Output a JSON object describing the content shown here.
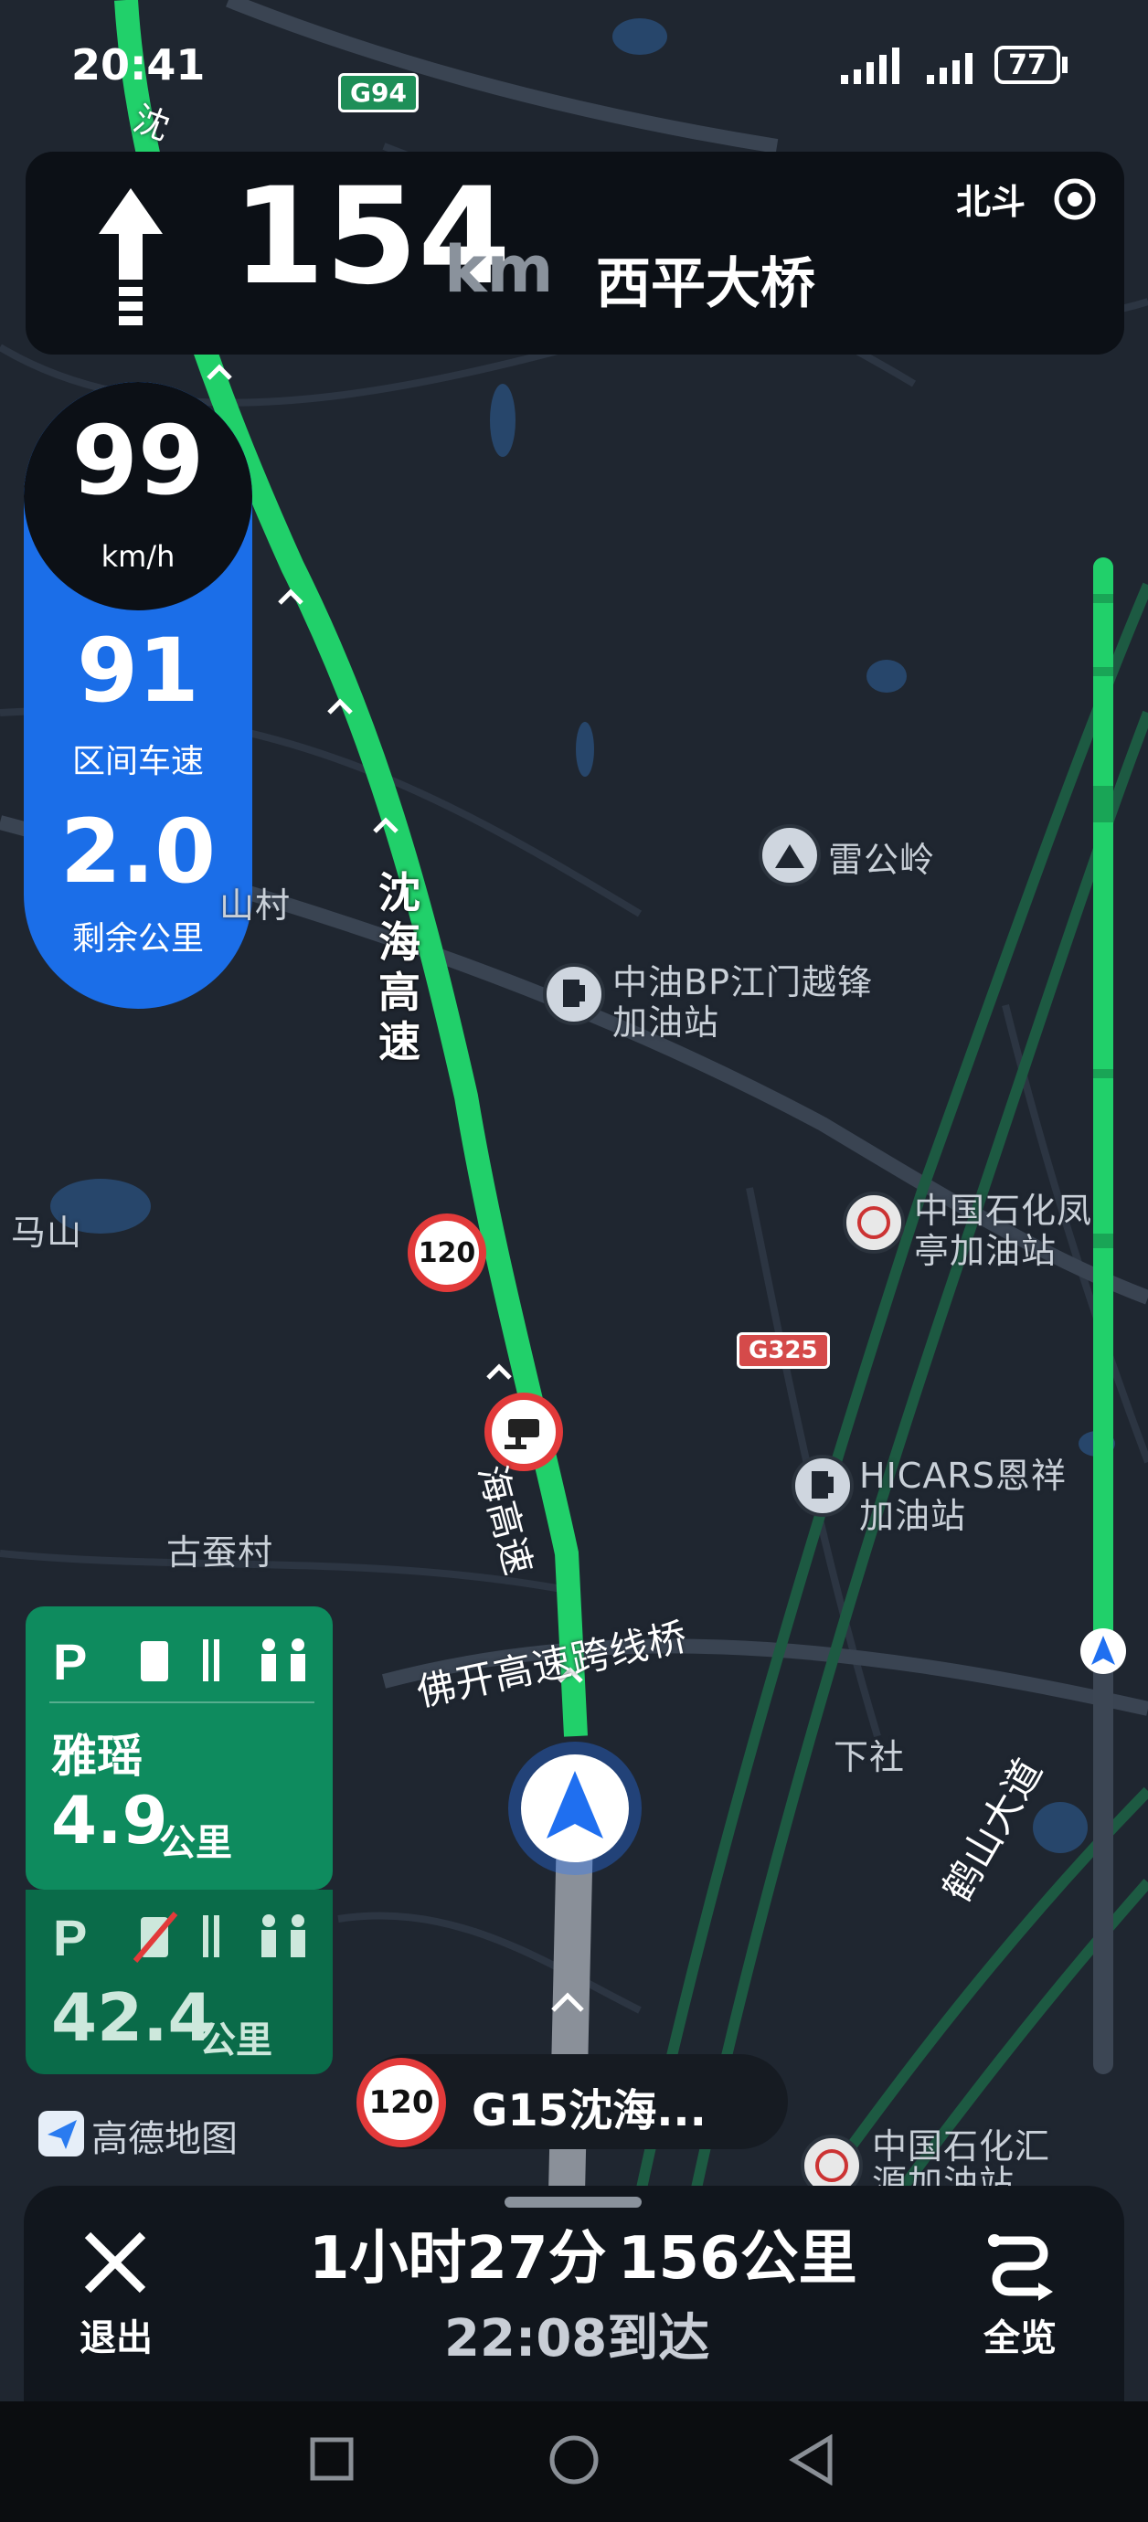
{
  "status_bar": {
    "time": "20:41",
    "battery": "77"
  },
  "guidance": {
    "distance_value": "154",
    "distance_unit": "km",
    "road_name": "西平大桥",
    "positioning": "北斗"
  },
  "speed_panel": {
    "current_speed": "99",
    "speed_unit": "km/h",
    "avg_speed": "91",
    "avg_label": "区间车速",
    "remaining": "2.0",
    "remaining_label": "剩余公里"
  },
  "map_labels": {
    "highway_vertical": [
      "沈",
      "海",
      "高",
      "速"
    ],
    "highway_top": "沈",
    "shield_g94": "G94",
    "shield_g325": "G325",
    "leigongling": "雷公岭",
    "station_bp_1": "中油BP江门越锋",
    "station_bp_2": "加油站",
    "station_sinopec_1": "中国石化凤",
    "station_sinopec_2": "亭加油站",
    "station_hicars_1": "HICARS恩祥",
    "station_hicars_2": "加油站",
    "station_bottom_1": "中国石化汇",
    "station_bottom_2": "源加油站",
    "mashan": "马山",
    "cun": "山村",
    "gucancun": "古蚕村",
    "bridge": "佛开高速跨线桥",
    "xiashe": "下社",
    "heshan": "鹤山大道",
    "hai_gao_su": "海高速",
    "speed_limit_sign": "120"
  },
  "service_area_1": {
    "name": "雅瑶",
    "distance": "4.9",
    "unit": "公里"
  },
  "service_area_2": {
    "distance": "42.4",
    "unit": "公里"
  },
  "road_chip": {
    "speed_limit": "120",
    "road": "G15沈海..."
  },
  "brand": "高德地图",
  "bottom_bar": {
    "exit_label": "退出",
    "duration": "1小时27分",
    "distance": "156公里",
    "arrival": "22:08到达",
    "overview_label": "全览"
  },
  "colors": {
    "route_green": "#21d06a",
    "panel_blue": "#1b6ee8",
    "service_green": "#0e8b5e",
    "limit_red": "#e23a3a"
  }
}
